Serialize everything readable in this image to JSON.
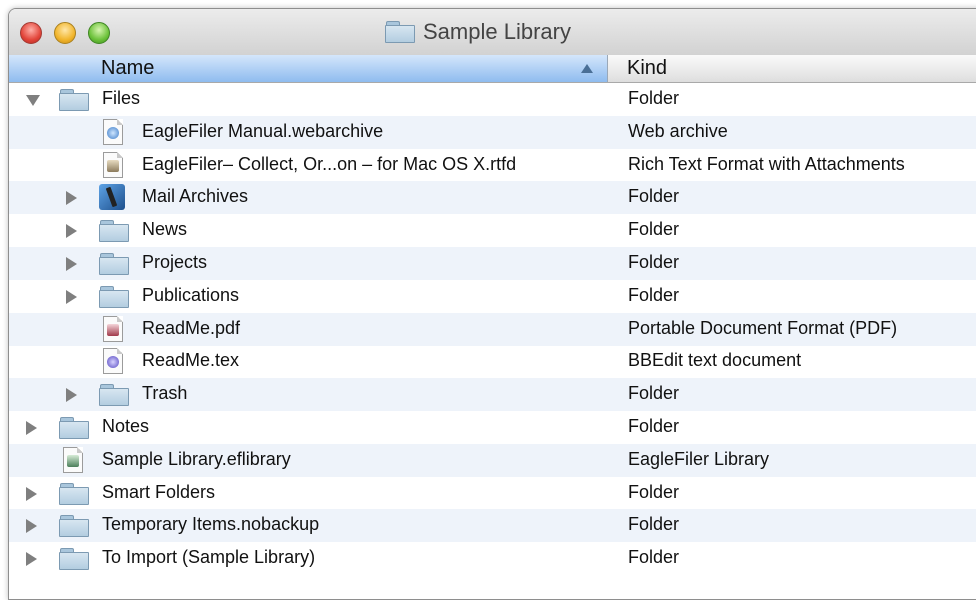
{
  "window": {
    "title": "Sample Library"
  },
  "columns": {
    "name": "Name",
    "kind": "Kind"
  },
  "rows": [
    {
      "name": "Files",
      "kind": "Folder",
      "icon": "folder-icon",
      "level": 0,
      "disclosure": "open"
    },
    {
      "name": "EagleFiler Manual.webarchive",
      "kind": "Web archive",
      "icon": "webarchive-file-icon",
      "level": 1,
      "disclosure": "none"
    },
    {
      "name": "EagleFiler– Collect, Or...on – for Mac OS X.rtfd",
      "kind": "Rich Text Format with Attachments",
      "icon": "rtfd-file-icon",
      "level": 1,
      "disclosure": "none"
    },
    {
      "name": "Mail Archives",
      "kind": "Folder",
      "icon": "mail-folder-icon",
      "level": 1,
      "disclosure": "closed"
    },
    {
      "name": "News",
      "kind": "Folder",
      "icon": "folder-icon",
      "level": 1,
      "disclosure": "closed"
    },
    {
      "name": "Projects",
      "kind": "Folder",
      "icon": "folder-icon",
      "level": 1,
      "disclosure": "closed"
    },
    {
      "name": "Publications",
      "kind": "Folder",
      "icon": "folder-icon",
      "level": 1,
      "disclosure": "closed"
    },
    {
      "name": "ReadMe.pdf",
      "kind": "Portable Document Format (PDF)",
      "icon": "pdf-file-icon",
      "level": 1,
      "disclosure": "none"
    },
    {
      "name": "ReadMe.tex",
      "kind": "BBEdit text document",
      "icon": "tex-file-icon",
      "level": 1,
      "disclosure": "none"
    },
    {
      "name": "Trash",
      "kind": "Folder",
      "icon": "folder-icon",
      "level": 1,
      "disclosure": "closed"
    },
    {
      "name": "Notes",
      "kind": "Folder",
      "icon": "folder-icon",
      "level": 0,
      "disclosure": "closed"
    },
    {
      "name": "Sample Library.eflibrary",
      "kind": "EagleFiler Library",
      "icon": "library-file-icon",
      "level": 0,
      "disclosure": "none"
    },
    {
      "name": "Smart Folders",
      "kind": "Folder",
      "icon": "folder-icon",
      "level": 0,
      "disclosure": "closed"
    },
    {
      "name": "Temporary Items.nobackup",
      "kind": "Folder",
      "icon": "folder-icon",
      "level": 0,
      "disclosure": "closed"
    },
    {
      "name": "To Import (Sample Library)",
      "kind": "Folder",
      "icon": "folder-icon",
      "level": 0,
      "disclosure": "closed"
    }
  ],
  "colors": {
    "header_selected": "#8fbcef",
    "row_alternate": "#eef3fa",
    "folder": "#b3cde0"
  }
}
